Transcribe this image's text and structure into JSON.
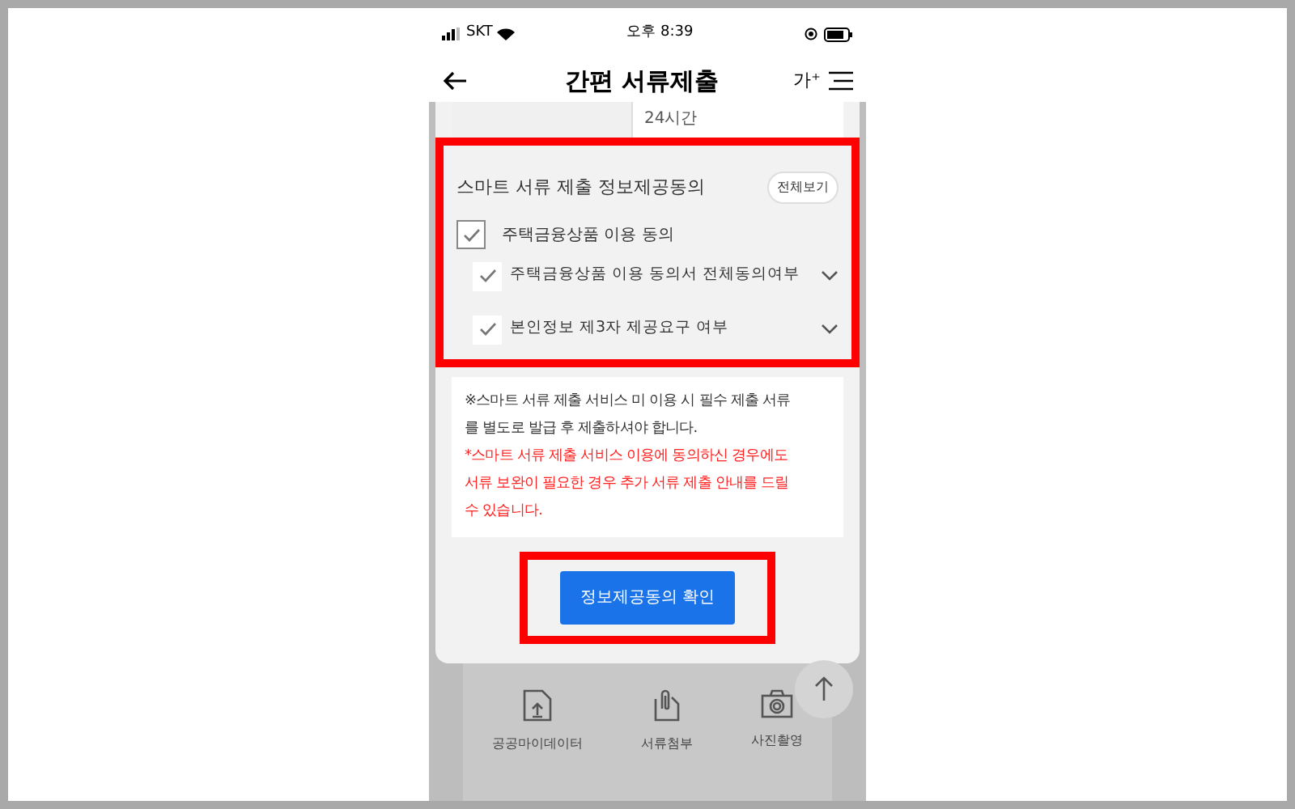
{
  "status_bar": {
    "carrier": "SKT",
    "time": "오후 8:39"
  },
  "header": {
    "title": "간편 서류제출",
    "font_button": "가⁺"
  },
  "info_row": {
    "value": "24시간"
  },
  "consent": {
    "title": "스마트 서류 제출 정보제공동의",
    "view_all": "전체보기",
    "main": {
      "label": "주택금융상품 이용 동의",
      "checked": true
    },
    "items": [
      {
        "label": "주택금융상품 이용 동의서 전체동의여부",
        "checked": true
      },
      {
        "label": "본인정보 제3자 제공요구 여부",
        "checked": true
      }
    ]
  },
  "notice": {
    "text": "※스마트 서류 제출 서비스 미 이용 시 필수 제출 서류를 별도로 발급 후 제출하셔야 합니다.",
    "warning": "*스마트 서류 제출 서비스 이용에 동의하신 경우에도 서류 보완이 필요한 경우 추가 서류 제출 안내를 드릴 수 있습니다."
  },
  "confirm_button": "정보제공동의 확인",
  "methods": [
    {
      "kind": "data",
      "label": "공공마이데이터"
    },
    {
      "kind": "attach",
      "label": "서류첨부"
    },
    {
      "kind": "camera",
      "label": "사진촬영"
    }
  ]
}
